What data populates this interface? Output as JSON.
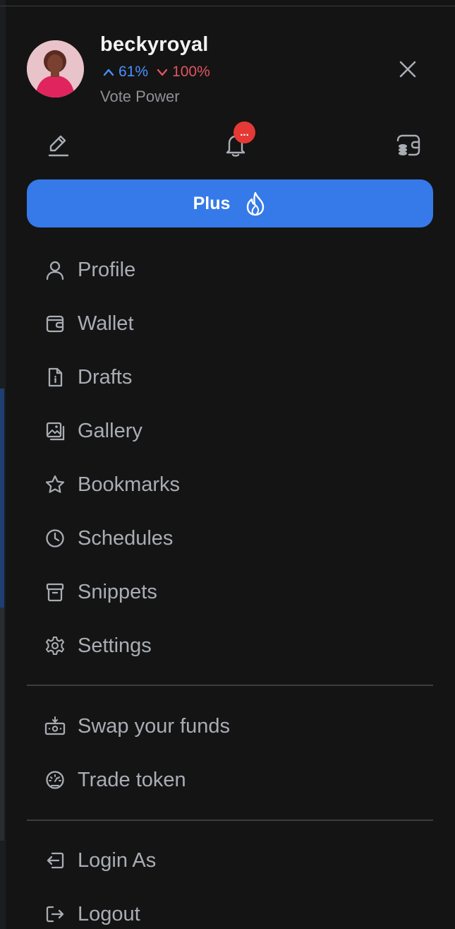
{
  "user": {
    "username": "beckyroyal",
    "upvote_power": "61%",
    "downvote_power": "100%",
    "vote_power_label": "Vote Power"
  },
  "notifications": {
    "badge": "..."
  },
  "plus_button": {
    "label": "Plus"
  },
  "menu": {
    "main": [
      {
        "label": "Profile",
        "icon": "user-icon"
      },
      {
        "label": "Wallet",
        "icon": "wallet-icon"
      },
      {
        "label": "Drafts",
        "icon": "document-icon"
      },
      {
        "label": "Gallery",
        "icon": "gallery-icon"
      },
      {
        "label": "Bookmarks",
        "icon": "star-icon"
      },
      {
        "label": "Schedules",
        "icon": "clock-icon"
      },
      {
        "label": "Snippets",
        "icon": "archive-icon"
      },
      {
        "label": "Settings",
        "icon": "gear-icon"
      }
    ],
    "funds": [
      {
        "label": "Swap your funds",
        "icon": "swap-icon"
      },
      {
        "label": "Trade token",
        "icon": "trade-icon"
      }
    ],
    "account": [
      {
        "label": "Login As",
        "icon": "login-icon"
      },
      {
        "label": "Logout",
        "icon": "logout-icon"
      }
    ]
  },
  "colors": {
    "background": "#141414",
    "accent": "#357ae8",
    "upvote": "#4a90ff",
    "downvote": "#e0555f",
    "badge": "#e53935",
    "menu_text": "#a9adb4"
  }
}
